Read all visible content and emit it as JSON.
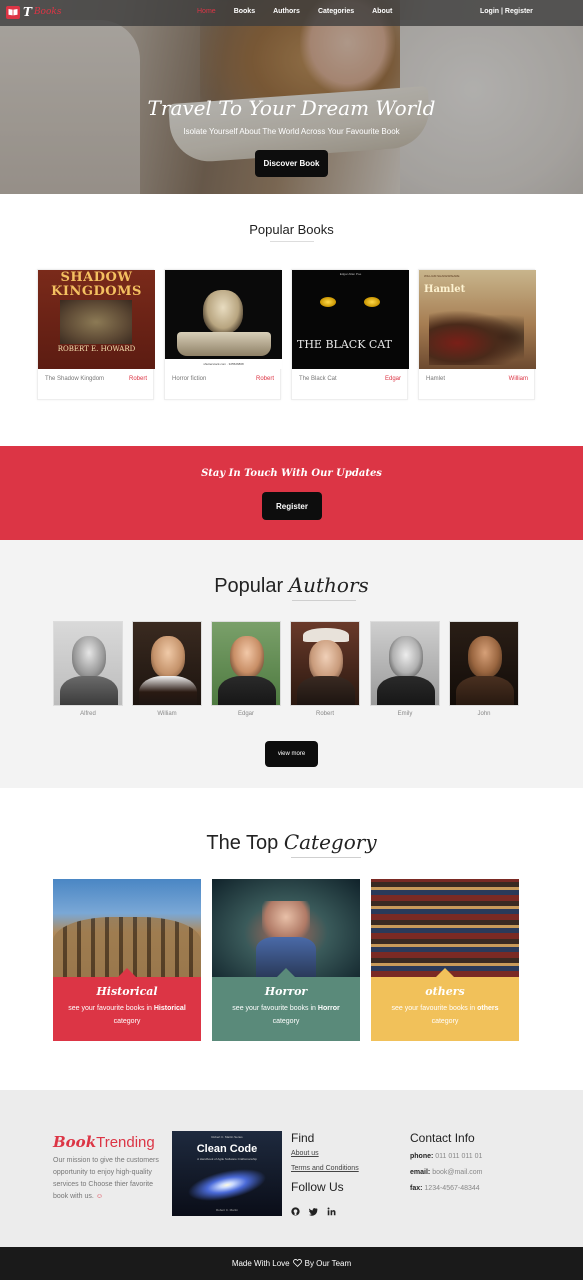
{
  "brand": {
    "logo_letter": "T",
    "logo_word": "Books"
  },
  "nav": {
    "items": [
      "Home",
      "Books",
      "Authors",
      "Categories",
      "About"
    ],
    "auth": "Login | Register"
  },
  "hero": {
    "title": "Travel To Your Dream World",
    "subtitle": "Isolate Yourself About The World Across Your Favourite Book",
    "button": "Discover Book"
  },
  "popular_books": {
    "title": "Popular Books",
    "books": [
      {
        "title": "The Shadow Kingdom",
        "author": "Robert",
        "cover": {
          "head": "SHADOW KINGDOMS",
          "foot": "ROBERT E. HOWARD"
        }
      },
      {
        "title": "Horror fiction",
        "author": "Robert",
        "cover": {
          "strip": "shutterstock.com · 325526868"
        }
      },
      {
        "title": "The Black Cat",
        "author": "Edgar",
        "cover": {
          "top": "Edgar Allan Poe",
          "text": "THE BLACK CAT"
        }
      },
      {
        "title": "Hamlet",
        "author": "William",
        "cover": {
          "small": "WILLIAM SHAKESPEARE",
          "head": "Hamlet"
        }
      }
    ]
  },
  "stay_in_touch": {
    "title": "Stay In Touch With Our Updates",
    "button": "Register"
  },
  "authors": {
    "title_plain": "Popular",
    "title_em": "Authors",
    "list": [
      "Alfred",
      "William",
      "Edgar",
      "Robert",
      "Emily",
      "John"
    ],
    "view_more": "view more"
  },
  "categories": {
    "title_plain": "The Top",
    "title_em": "Category",
    "list": [
      {
        "name": "Historical",
        "desc_pre": "see your favourite books in",
        "desc_bold": "Historical",
        "desc_post": "category",
        "color": "#dc3545"
      },
      {
        "name": "Horror",
        "desc_pre": "see your favourite books in",
        "desc_bold": "Horror",
        "desc_post": "category",
        "color": "#5a8a7a"
      },
      {
        "name": "others",
        "desc_pre": "see your favourite books in",
        "desc_bold": "others",
        "desc_post": "category",
        "color": "#f1c15a"
      }
    ]
  },
  "footer": {
    "brand_em": "Book",
    "brand_rest": "Trending",
    "mission": "Our mission to give the customers opportunity to enjoy high-quality services to Choose thier favorite book with us.",
    "mission_emoji": "☺",
    "featured_book": {
      "top": "Robert C. Martin Series",
      "title": "Clean Code",
      "subtitle": "A Handbook of Agile Software Craftsmanship",
      "bottom": "Robert C. Martin"
    },
    "find": {
      "title": "Find",
      "links": [
        "About us",
        "Terms and Conditions"
      ]
    },
    "follow": {
      "title": "Follow Us",
      "icons": [
        "github-icon",
        "twitter-icon",
        "linkedin-icon"
      ]
    },
    "contact": {
      "title": "Contact Info",
      "phone_label": "phone:",
      "phone": "011 011 011 01",
      "email_label": "email:",
      "email": "book@mail.com",
      "fax_label": "fax:",
      "fax": "1234-4567-48344"
    }
  },
  "bottom_bar": {
    "pre": "Made With Love",
    "post": "By Our Team",
    "icon": "heart-icon"
  },
  "colors": {
    "accent": "#dc3545",
    "dark": "#0d0d0d",
    "horror": "#5a8a7a",
    "others": "#f1c15a"
  }
}
